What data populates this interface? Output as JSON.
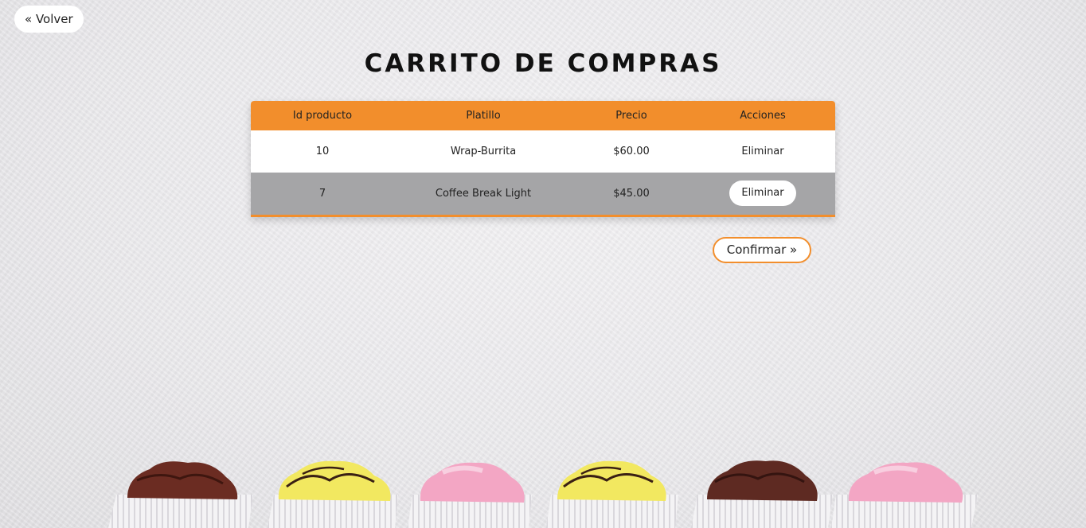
{
  "nav": {
    "back_label": "« Volver"
  },
  "page": {
    "title": "CARRITO DE COMPRAS"
  },
  "table": {
    "headers": [
      "Id producto",
      "Platillo",
      "Precio",
      "Acciones"
    ],
    "rows": [
      {
        "id": "10",
        "name": "Wrap-Burrita",
        "price": "$60.00",
        "action": "Eliminar"
      },
      {
        "id": "7",
        "name": "Coffee Break Light",
        "price": "$45.00",
        "action": "Eliminar"
      }
    ]
  },
  "footer": {
    "confirm_label": "Confirmar »"
  },
  "colors": {
    "accent": "#f28e2c",
    "row_alt": "#a5a5a7",
    "background": "#ecebee"
  },
  "decoration": {
    "cupcakes": [
      "chocolate",
      "lemon",
      "strawberry",
      "lemon",
      "chocolate",
      "strawberry"
    ]
  }
}
